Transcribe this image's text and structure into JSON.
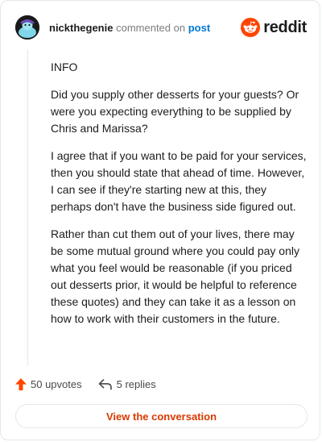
{
  "header": {
    "username": "nickthegenie",
    "action": "commented on",
    "post_link": "post",
    "brand": "reddit"
  },
  "comment": {
    "paragraphs": [
      "INFO",
      "Did you supply other desserts for your guests? Or were you expecting everything to be supplied by Chris and Marissa?",
      "I agree that if you want to be paid for your services, then you should state that ahead of time. However, I can see if they're starting new at this, they perhaps don't have the business side figured out.",
      "Rather than cut them out of your lives, there may be some mutual ground where you could pay only what you feel would be reasonable (if you priced out desserts prior, it would be helpful to reference these quotes) and they can take it as a lesson on how to work with their customers in the future."
    ]
  },
  "stats": {
    "upvotes": "50 upvotes",
    "replies": "5 replies"
  },
  "view_button": "View the conversation",
  "colors": {
    "brand_orange": "#ff4500",
    "link_blue": "#0079d3",
    "button_text": "#d93a00"
  },
  "icons": [
    "avatar-icon",
    "reddit-logo-icon",
    "upvote-arrow-icon",
    "reply-icon"
  ]
}
